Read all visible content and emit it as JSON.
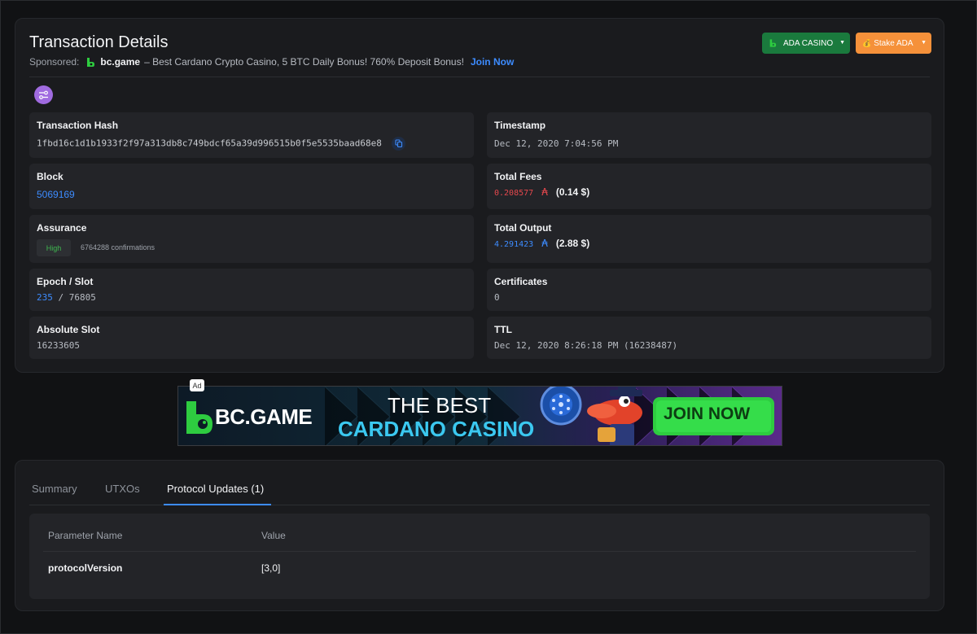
{
  "header": {
    "title": "Transaction Details",
    "sponsored_label": "Sponsored:",
    "sponsor_brand": "bc.game",
    "sponsor_text": "– Best Cardano Crypto Casino, 5 BTC Daily Bonus! 760% Deposit Bonus!",
    "join_label": "Join Now",
    "ada_casino_button": "ADA CASINO",
    "stake_button": "Stake ADA"
  },
  "fields": {
    "tx_hash_label": "Transaction Hash",
    "tx_hash": "1fbd16c1d1b1933f2f97a313db8c749bdcf65a39d996515b0f5e5535baad68e8",
    "timestamp_label": "Timestamp",
    "timestamp": "Dec 12, 2020 7:04:56 PM",
    "block_label": "Block",
    "block": "5069169",
    "total_fees_label": "Total Fees",
    "total_fees_ada": "0.208577",
    "total_fees_usd": "(0.14 $)",
    "assurance_label": "Assurance",
    "assurance_badge": "High",
    "confirmations": "6764288 confirmations",
    "total_output_label": "Total Output",
    "total_output_ada": "4.291423",
    "total_output_usd": "(2.88 $)",
    "epoch_slot_label": "Epoch / Slot",
    "epoch": "235",
    "slot_separator": "/",
    "slot": "76805",
    "certificates_label": "Certificates",
    "certificates": "0",
    "absolute_slot_label": "Absolute Slot",
    "absolute_slot": "16233605",
    "ttl_label": "TTL",
    "ttl": "Dec 12, 2020 8:26:18 PM (16238487)",
    "ada_symbol": "₳"
  },
  "ad": {
    "tag": "Ad",
    "brand": "BC.GAME",
    "line1": "THE BEST",
    "line2": "CARDANO CASINO",
    "cta": "JOIN NOW"
  },
  "tabs": {
    "items": [
      "Summary",
      "UTXOs",
      "Protocol Updates (1)"
    ],
    "active": "Protocol Updates (1)"
  },
  "protocol_table": {
    "headers": [
      "Parameter Name",
      "Value"
    ],
    "rows": [
      {
        "name": "protocolVersion",
        "value": "[3,0]"
      }
    ]
  },
  "colors": {
    "accent_blue": "#3d8cff",
    "fee_red": "#e5484d",
    "success_green": "#3fb950",
    "ada_casino_green": "#1a7a3d",
    "stake_orange": "#f5913a",
    "icon_purple": "#a06be0"
  },
  "icons": [
    "bc-game-logo-icon",
    "chevron-down-icon",
    "settings-sliders-icon",
    "copy-icon",
    "ada-icon"
  ]
}
